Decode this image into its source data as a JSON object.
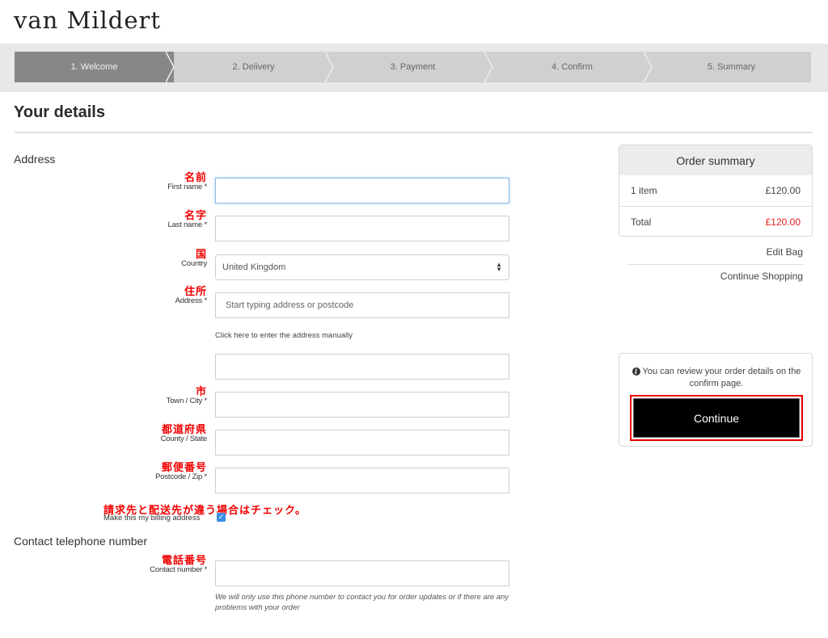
{
  "brand": {
    "logo_text": "van Mildert"
  },
  "progress": {
    "steps": [
      {
        "label": "1. Welcome",
        "active": true
      },
      {
        "label": "2. Delivery",
        "active": false
      },
      {
        "label": "3. Payment",
        "active": false
      },
      {
        "label": "4. Confirm",
        "active": false
      },
      {
        "label": "5. Summary",
        "active": false
      }
    ]
  },
  "page": {
    "title": "Your details"
  },
  "address": {
    "heading": "Address",
    "first_name": {
      "jp": "名前",
      "label": "First name *",
      "value": ""
    },
    "last_name": {
      "jp": "名字",
      "label": "Last name *",
      "value": ""
    },
    "country": {
      "jp": "国",
      "label": "Country",
      "value": "United Kingdom"
    },
    "address": {
      "jp": "住所",
      "label": "Address *",
      "placeholder": "Start typing address or postcode"
    },
    "manual_link": "Click here to enter the address manually",
    "address_line2": {
      "value": ""
    },
    "town": {
      "jp": "市",
      "label": "Town / City *",
      "value": ""
    },
    "county": {
      "jp": "都道府県",
      "label": "County / State",
      "value": ""
    },
    "postcode": {
      "jp": "郵便番号",
      "label": "Postcode / Zip *",
      "value": ""
    },
    "billing": {
      "jp_note": "請求先と配送先が違う場合はチェック。",
      "label": "Make this my billing address",
      "checked": true,
      "check_glyph": "✓"
    }
  },
  "contact": {
    "heading": "Contact telephone number",
    "phone": {
      "jp": "電話番号",
      "label": "Contact number *",
      "value": ""
    },
    "help": "We will only use this phone number to contact you for order updates or if there are any problems with your order"
  },
  "order_summary": {
    "heading": "Order summary",
    "items_label": "1 item",
    "items_value": "£120.00",
    "total_label": "Total",
    "total_value": "£120.00",
    "accent_color": "#e41c1c"
  },
  "side_links": {
    "edit_bag": "Edit Bag",
    "continue_shopping": "Continue Shopping"
  },
  "continue_panel": {
    "info_icon": "info-circle-icon",
    "info_glyph": "i",
    "info_text": "You can review your order details on the confirm page.",
    "button_label": "Continue",
    "highlight_color": "#e60000"
  }
}
